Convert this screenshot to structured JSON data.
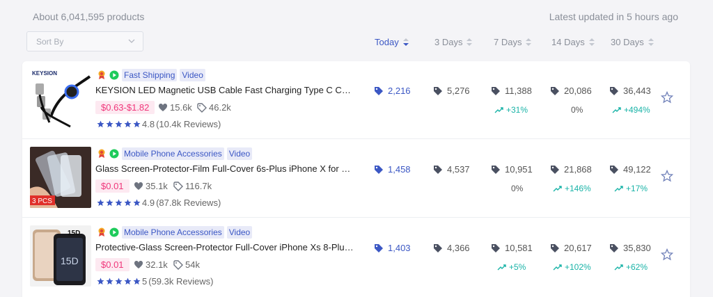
{
  "header": {
    "product_count": "About 6,041,595 products",
    "updated": "Latest updated in 5 hours ago",
    "sort_placeholder": "Sort By"
  },
  "columns": [
    {
      "label": "Today",
      "active": true
    },
    {
      "label": "3 Days",
      "active": false
    },
    {
      "label": "7 Days",
      "active": false
    },
    {
      "label": "14 Days",
      "active": false
    },
    {
      "label": "30 Days",
      "active": false
    }
  ],
  "products": [
    {
      "tags": [
        "Fast Shipping",
        "Video"
      ],
      "title": "KEYSION LED Magnetic USB Cable Fast Charging Type C Cable M...",
      "price": "$0.63-$1.82",
      "likes": "15.6k",
      "orders": "46.2k",
      "rating": "4.8",
      "reviews": "(10.4k Reviews)",
      "thumb_label": "KEYSION",
      "stats": [
        {
          "value": "2,216",
          "delta": ""
        },
        {
          "value": "5,276",
          "delta": ""
        },
        {
          "value": "11,388",
          "delta": "+31%"
        },
        {
          "value": "20,086",
          "delta": "0%"
        },
        {
          "value": "36,443",
          "delta": "+494%"
        }
      ]
    },
    {
      "tags": [
        "Mobile Phone Accessories",
        "Video"
      ],
      "title": "Glass Screen-Protector-Film Full-Cover 6s-Plus iPhone X for XS M...",
      "price": "$0.01",
      "likes": "35.1k",
      "orders": "116.7k",
      "rating": "4.9",
      "reviews": "(87.8k Reviews)",
      "thumb_label": "3 PCS",
      "stats": [
        {
          "value": "1,458",
          "delta": ""
        },
        {
          "value": "4,537",
          "delta": ""
        },
        {
          "value": "10,951",
          "delta": "0%"
        },
        {
          "value": "21,868",
          "delta": "+146%"
        },
        {
          "value": "49,122",
          "delta": "+17%"
        }
      ]
    },
    {
      "tags": [
        "Mobile Phone Accessories",
        "Video"
      ],
      "title": "Protective-Glass Screen-Protector Full-Cover iPhone Xs 8-Plus Ma...",
      "price": "$0.01",
      "likes": "32.1k",
      "orders": "54k",
      "rating": "5",
      "reviews": "(59.3k Reviews)",
      "thumb_label": "15D",
      "stats": [
        {
          "value": "1,403",
          "delta": ""
        },
        {
          "value": "4,366",
          "delta": ""
        },
        {
          "value": "10,581",
          "delta": "+5%"
        },
        {
          "value": "20,617",
          "delta": "+102%"
        },
        {
          "value": "35,830",
          "delta": "+62%"
        }
      ]
    }
  ],
  "colors": {
    "accent": "#3b57c4",
    "price": "#f0367a",
    "up": "#19b3a7"
  }
}
